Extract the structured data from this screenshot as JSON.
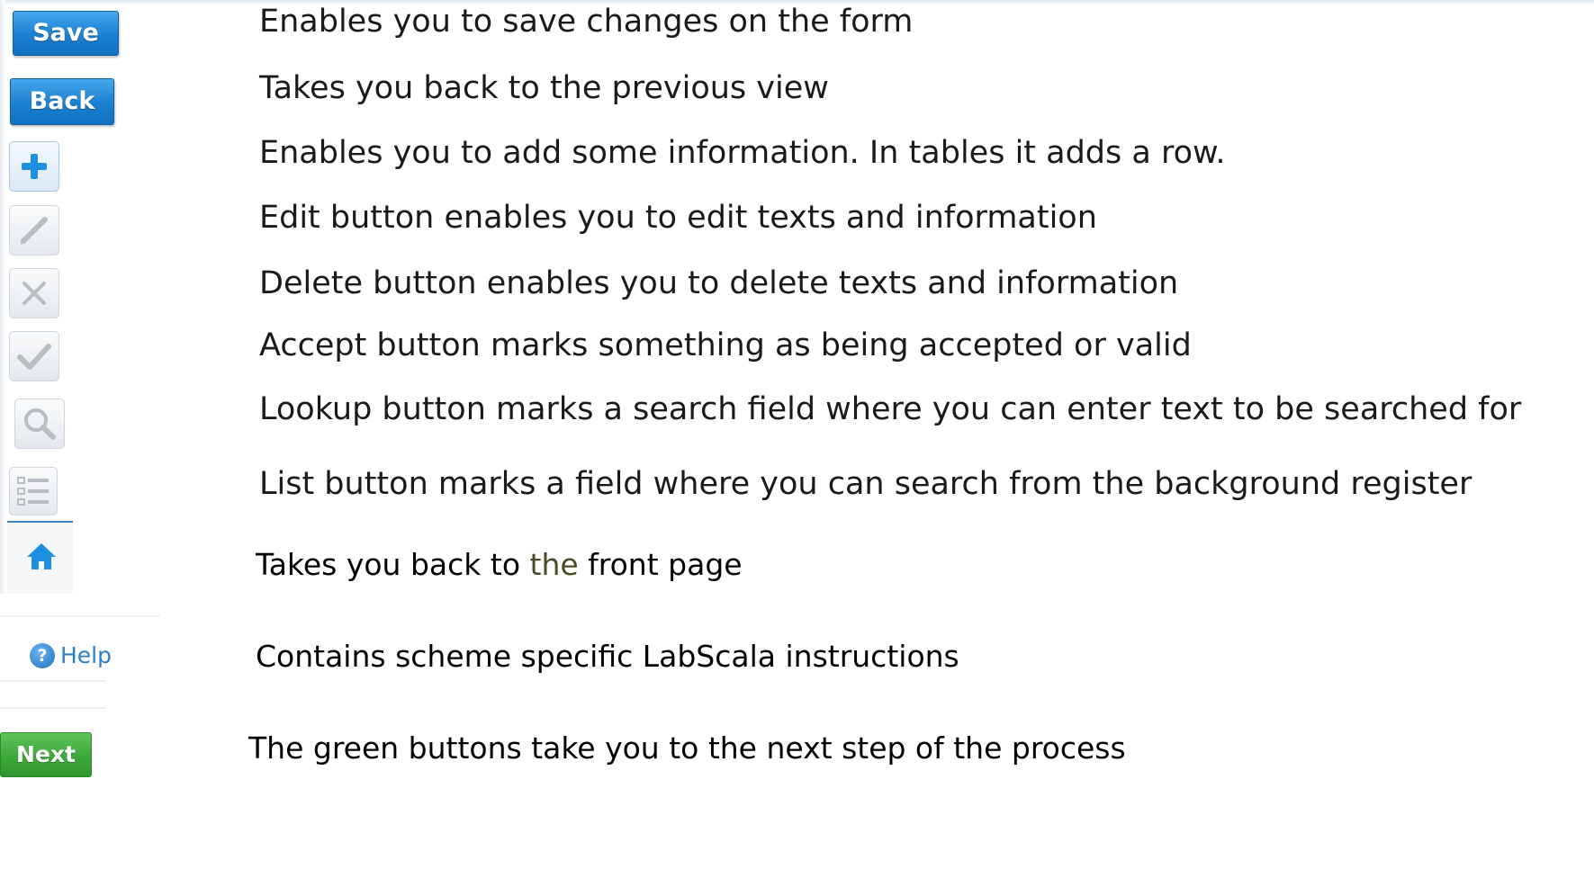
{
  "buttons": {
    "save_label": "Save",
    "back_label": "Back",
    "help_label": "Help",
    "next_label": "Next"
  },
  "icons": [
    "add-icon",
    "edit-icon",
    "delete-icon",
    "accept-icon",
    "lookup-icon",
    "list-icon",
    "home-icon",
    "help-icon"
  ],
  "descriptions": {
    "save": "Enables you to save changes on the form",
    "back": "Takes you back to the previous view",
    "add": "Enables you to add some information. In tables it adds a row.",
    "edit": "Edit button enables you to edit texts and information",
    "delete": "Delete button enables you to delete texts and information",
    "accept": "Accept button marks something as being accepted or valid",
    "lookup": "Lookup button marks a search field where you can enter text to be searched for",
    "list": "List button marks a field where you can search from the background register",
    "home_prefix": "Takes you back to ",
    "home_the": "the",
    "home_suffix": " front page",
    "help": "Contains scheme specific LabScala instructions",
    "next": "The green buttons take you to the next step of the process"
  },
  "colors": {
    "blue_button": "#1b7fd0",
    "green_button": "#3ea83a",
    "icon_blue": "#1f8fe0",
    "icon_grey": "#b9bec4",
    "text": "#1a1a1a"
  }
}
